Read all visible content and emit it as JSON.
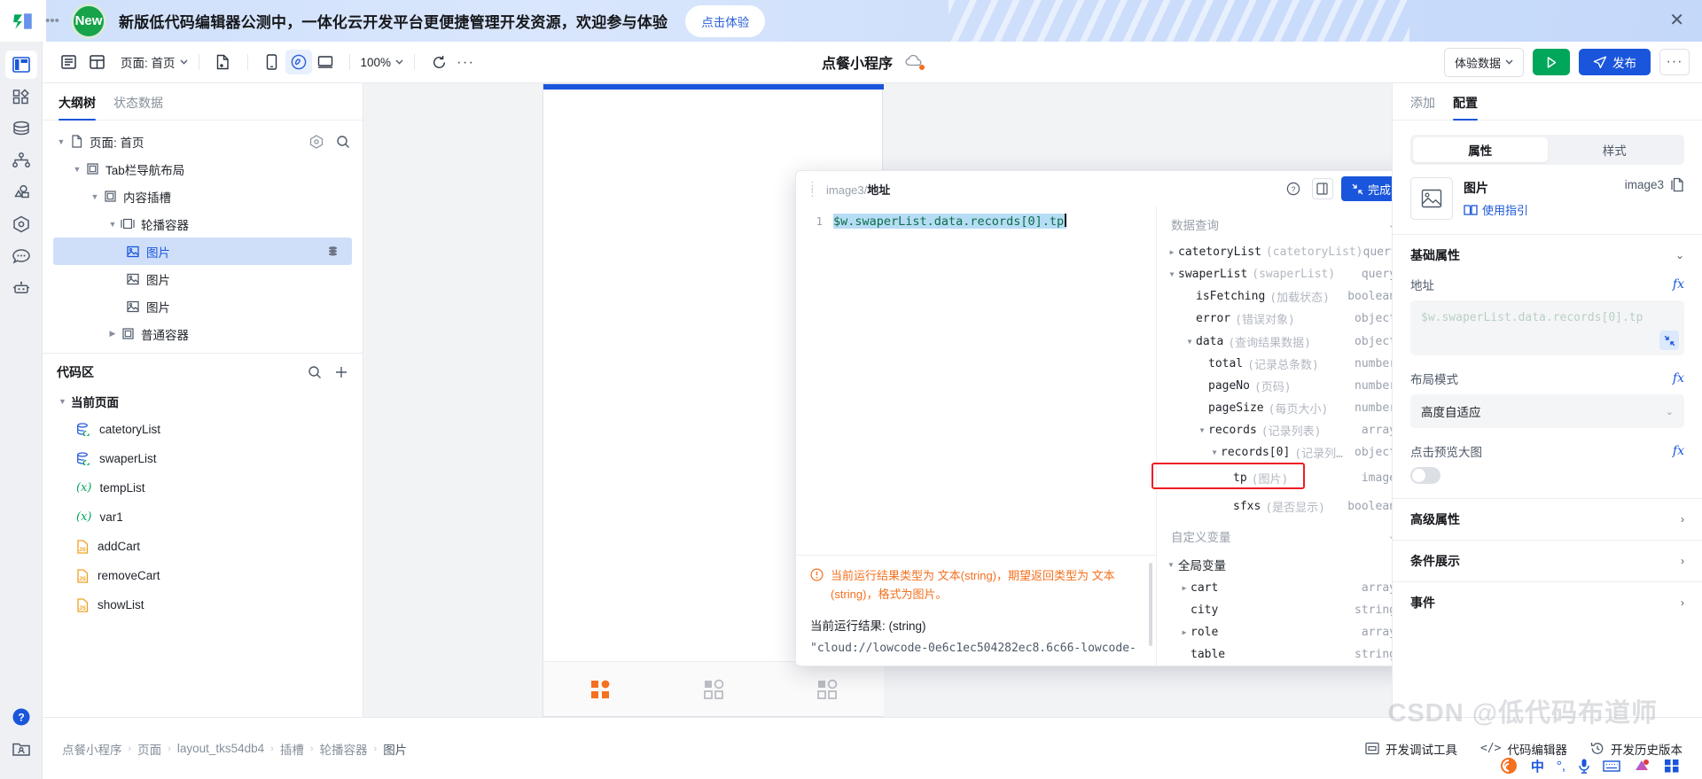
{
  "promo": {
    "badge": "New",
    "text": "新版低代码编辑器公测中，一体化云开发平台更便捷管理开发资源，欢迎参与体验",
    "cta": "点击体验",
    "close_icon": "close-icon"
  },
  "rail": {
    "items": [
      {
        "name": "layout-icon",
        "label": "页面布局",
        "active": true
      },
      {
        "name": "components-icon",
        "label": "组件"
      },
      {
        "name": "database-icon",
        "label": "数据源"
      },
      {
        "name": "flow-icon",
        "label": "流程"
      },
      {
        "name": "shapes-icon",
        "label": "素材"
      },
      {
        "name": "settings-hex-icon",
        "label": "设置"
      },
      {
        "name": "chat-icon",
        "label": "反馈"
      },
      {
        "name": "robot-icon",
        "label": "AI助手"
      }
    ],
    "bottom": [
      {
        "name": "help-icon",
        "label": "帮助"
      },
      {
        "name": "account-folder-icon",
        "label": "账户"
      }
    ]
  },
  "toolbar": {
    "outline_icon": "outline-panel-icon",
    "layout_icon": "layout-grid-icon",
    "page_label": "页面: 首页",
    "new_page_icon": "new-page-icon",
    "device_phone_icon": "phone-icon",
    "device_mini_icon": "miniprogram-icon",
    "device_desktop_icon": "desktop-icon",
    "zoom_label": "100%",
    "refresh_icon": "refresh-icon",
    "more_icon": "more-horizontal-icon",
    "app_title": "点餐小程序",
    "cloud_icon": "cloud-icon",
    "data_label": "体验数据",
    "run_icon": "play-icon",
    "publish_label": "发布",
    "publish_icon": "send-icon",
    "more_label": "···"
  },
  "left_panel": {
    "tabs": [
      {
        "label": "大纲树",
        "active": true
      },
      {
        "label": "状态数据",
        "active": false
      }
    ],
    "tree": [
      {
        "label": "页面: 首页",
        "icon": "page-icon",
        "depth": 0,
        "caret": "down",
        "actions": [
          "target-icon",
          "search-icon"
        ]
      },
      {
        "label": "Tab栏导航布局",
        "icon": "container-icon",
        "depth": 1,
        "caret": "down"
      },
      {
        "label": "内容插槽",
        "icon": "container-icon",
        "depth": 2,
        "caret": "down"
      },
      {
        "label": "轮播容器",
        "icon": "carousel-icon",
        "depth": 3,
        "caret": "down"
      },
      {
        "label": "图片",
        "icon": "image-icon",
        "depth": 4,
        "caret": "none",
        "selected": true,
        "badge": "data-bind-icon"
      },
      {
        "label": "图片",
        "icon": "image-icon",
        "depth": 4,
        "caret": "none"
      },
      {
        "label": "图片",
        "icon": "image-icon",
        "depth": 4,
        "caret": "none"
      },
      {
        "label": "普通容器",
        "icon": "container-icon",
        "depth": 3,
        "caret": "right"
      }
    ],
    "code_zone": {
      "title": "代码区",
      "search_icon": "search-icon",
      "add_icon": "plus-icon",
      "group_label": "当前页面",
      "items": [
        {
          "label": "catetoryList",
          "icon": "query-icon"
        },
        {
          "label": "swaperList",
          "icon": "query-icon"
        },
        {
          "label": "tempList",
          "icon": "variable-icon"
        },
        {
          "label": "var1",
          "icon": "variable-icon"
        },
        {
          "label": "addCart",
          "icon": "js-file-icon"
        },
        {
          "label": "removeCart",
          "icon": "js-file-icon"
        },
        {
          "label": "showList",
          "icon": "js-file-icon"
        }
      ]
    }
  },
  "modal": {
    "drag_icon": "drag-handle-icon",
    "path_prefix": "image3",
    "path_sep": "/",
    "path_suffix": "地址",
    "help_icon": "help-circle-icon",
    "panel_icon": "side-panel-icon",
    "done_label": "完成",
    "done_icon": "collapse-icon",
    "editor": {
      "line_number": "1",
      "code": "$w.swaperList.data.records[0].tp"
    },
    "result": {
      "warning": "当前运行结果类型为 文本(string)，期望返回类型为 文本(string)，格式为图片。",
      "warning_icon": "warning-circle-icon",
      "result_label": "当前运行结果: (string)",
      "result_value": "\"cloud://lowcode-0e6c1ec504282ec8.6c66-lowcode-"
    },
    "vars": {
      "query_section": "数据查询",
      "query_rows": [
        {
          "name": "catetoryList",
          "desc": "(catetoryList)",
          "type": "query",
          "depth": 0,
          "caret": "right"
        },
        {
          "name": "swaperList",
          "desc": "(swaperList)",
          "type": "query",
          "depth": 0,
          "caret": "down"
        },
        {
          "name": "isFetching",
          "desc": "(加载状态)",
          "type": "boolean",
          "depth": 1,
          "caret": "none"
        },
        {
          "name": "error",
          "desc": "(错误对象)",
          "type": "object",
          "depth": 1,
          "caret": "none"
        },
        {
          "name": "data",
          "desc": "(查询结果数据)",
          "type": "object",
          "depth": 1,
          "caret": "down"
        },
        {
          "name": "total",
          "desc": "(记录总条数)",
          "type": "number",
          "depth": 2,
          "caret": "none"
        },
        {
          "name": "pageNo",
          "desc": "(页码)",
          "type": "number",
          "depth": 2,
          "caret": "none"
        },
        {
          "name": "pageSize",
          "desc": "(每页大小)",
          "type": "number",
          "depth": 2,
          "caret": "none"
        },
        {
          "name": "records",
          "desc": "(记录列表)",
          "type": "array",
          "depth": 2,
          "caret": "down"
        },
        {
          "name": "records[0]",
          "desc": "(记录列…",
          "type": "object",
          "depth": 3,
          "caret": "down"
        },
        {
          "name": "tp",
          "desc": "(图片)",
          "type": "image",
          "depth": 4,
          "caret": "none",
          "highlighted": true
        },
        {
          "name": "sfxs",
          "desc": "(是否显示)",
          "type": "boolean",
          "depth": 4,
          "caret": "none"
        }
      ],
      "custom_section": "自定义变量",
      "global_section": "全局变量",
      "global_rows": [
        {
          "name": "cart",
          "desc": "",
          "type": "array",
          "depth": 1,
          "caret": "right"
        },
        {
          "name": "city",
          "desc": "",
          "type": "string",
          "depth": 1,
          "caret": "none"
        },
        {
          "name": "role",
          "desc": "",
          "type": "array",
          "depth": 1,
          "caret": "right"
        },
        {
          "name": "table",
          "desc": "",
          "type": "string",
          "depth": 1,
          "caret": "none"
        }
      ]
    }
  },
  "right_panel": {
    "tabs": [
      {
        "label": "添加",
        "active": false
      },
      {
        "label": "配置",
        "active": true
      }
    ],
    "segments": [
      {
        "label": "属性",
        "active": true
      },
      {
        "label": "样式",
        "active": false
      }
    ],
    "component": {
      "thumb_icon": "image-icon",
      "name": "图片",
      "guide_label": "使用指引",
      "guide_icon": "book-icon",
      "id": "image3",
      "copy_icon": "copy-icon"
    },
    "sections": [
      {
        "label": "基础属性",
        "state": "expanded"
      },
      {
        "label": "高级属性",
        "state": "collapsed"
      },
      {
        "label": "条件展示",
        "state": "collapsed"
      },
      {
        "label": "事件",
        "state": "collapsed"
      }
    ],
    "fields": {
      "address_label": "地址",
      "address_value": "$w.swaperList.data.records[0].tp",
      "address_fx": "fx",
      "expand_icon": "expand-icon",
      "layout_label": "布局模式",
      "layout_value": "高度自适应",
      "layout_fx": "fx",
      "preview_label": "点击预览大图",
      "preview_fx": "fx",
      "preview_enabled": false
    }
  },
  "status_bar": {
    "breadcrumbs": [
      "点餐小程序",
      "页面",
      "layout_tks54db4",
      "插槽",
      "轮播容器",
      "图片"
    ],
    "actions": [
      {
        "label": "开发调试工具",
        "icon": "debug-icon"
      },
      {
        "label": "代码编辑器",
        "icon": "code-icon"
      },
      {
        "label": "开发历史版本",
        "icon": "history-icon"
      }
    ]
  },
  "watermark": "CSDN @低代码布道师",
  "colors": {
    "primary": "#1a56db",
    "success": "#00a65a",
    "warning": "#f5701f",
    "danger": "#ee1c25",
    "selected_bg": "#cfdffa"
  }
}
